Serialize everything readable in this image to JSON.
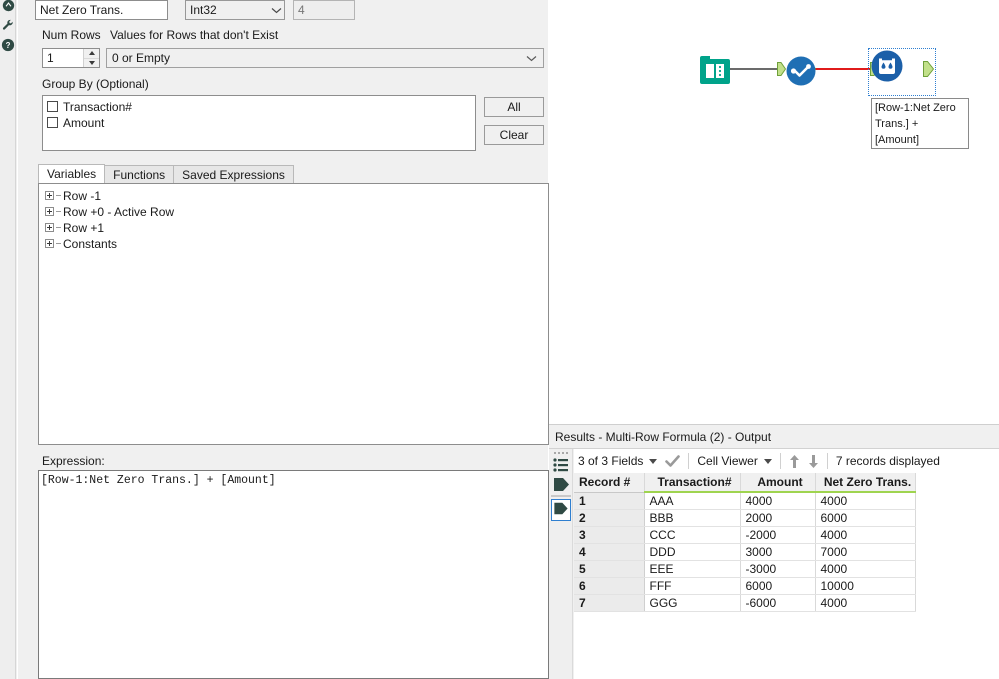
{
  "config": {
    "rail_icons": [
      "wrench-icon",
      "help-icon"
    ],
    "field": {
      "name_value": "Net Zero Trans.",
      "type_value": "Int32",
      "size_value": "4"
    },
    "num_rows": {
      "label": "Num Rows",
      "value": "1"
    },
    "values_for_rows": {
      "label": "Values for Rows that don't Exist",
      "value": "0 or Empty"
    },
    "group_by": {
      "label": "Group By (Optional)",
      "items": [
        {
          "label": "Transaction#",
          "checked": false
        },
        {
          "label": "Amount",
          "checked": false
        }
      ],
      "all_button": "All",
      "clear_button": "Clear"
    },
    "tabs": [
      {
        "label": "Variables",
        "active": true
      },
      {
        "label": "Functions",
        "active": false
      },
      {
        "label": "Saved Expressions",
        "active": false
      }
    ],
    "variables_tree": [
      "Row -1",
      "Row +0 - Active Row",
      "Row +1",
      "Constants"
    ],
    "expression": {
      "label": "Expression:",
      "text": "[Row-1:Net Zero Trans.] + [Amount]"
    }
  },
  "canvas": {
    "nodes": [
      {
        "id": "input-data-tool",
        "icon": "book-input-icon",
        "color": "#00a38a"
      },
      {
        "id": "select-tool",
        "icon": "check-select-icon",
        "color": "#1f6fb4"
      },
      {
        "id": "multi-row-formula-tool",
        "icon": "multirow-formula-icon",
        "color": "#1b5fa8",
        "selected": true
      }
    ],
    "connections": [
      {
        "from": "input-data-tool",
        "to": "select-tool",
        "color": "#6b6b6b"
      },
      {
        "from": "select-tool",
        "to": "multi-row-formula-tool",
        "color": "#e01b1b"
      }
    ],
    "annotation": "[Row-1:Net Zero Trans.] + [Amount]"
  },
  "results": {
    "title": "Results - Multi-Row Formula (2) - Output",
    "toolbar": {
      "fields_label": "3 of 3 Fields",
      "viewer_label": "Cell Viewer",
      "records_label": "7 records displayed",
      "sort_asc_icon": "arrow-up-icon",
      "sort_desc_icon": "arrow-down-icon",
      "check_icon": "check-icon"
    },
    "table": {
      "columns": [
        "Record #",
        "Transaction#",
        "Amount",
        "Net Zero Trans."
      ],
      "rows": [
        [
          "1",
          "AAA",
          "4000",
          "4000"
        ],
        [
          "2",
          "BBB",
          "2000",
          "6000"
        ],
        [
          "3",
          "CCC",
          "-2000",
          "4000"
        ],
        [
          "4",
          "DDD",
          "3000",
          "7000"
        ],
        [
          "5",
          "EEE",
          "-3000",
          "4000"
        ],
        [
          "6",
          "FFF",
          "6000",
          "10000"
        ],
        [
          "7",
          "GGG",
          "-6000",
          "4000"
        ]
      ]
    }
  },
  "colors": {
    "accent_green": "#9fd44f",
    "node_teal": "#00a38a",
    "node_blue": "#1f6fb4",
    "connection_red": "#e01b1b",
    "selection_blue": "#2f7fd0"
  }
}
